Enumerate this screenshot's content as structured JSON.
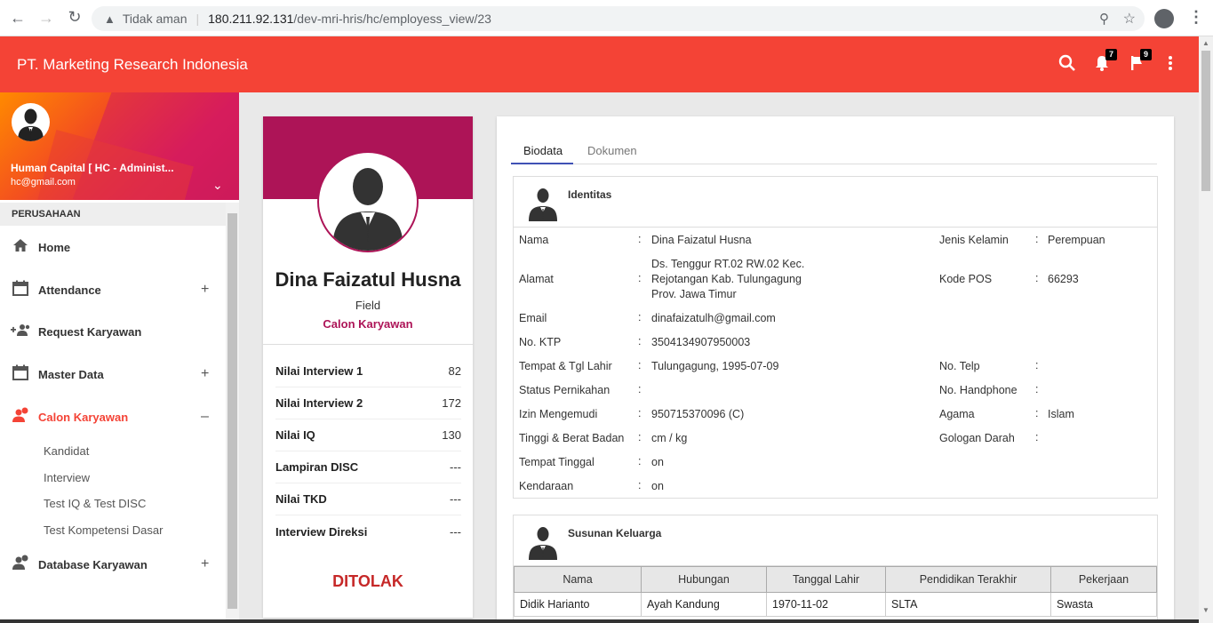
{
  "browser": {
    "insecure_label": "Tidak aman",
    "url_host": "180.211.92.131",
    "url_path": "/dev-mri-hris/hc/employess_view/23"
  },
  "header": {
    "brand": "PT. Marketing Research Indonesia",
    "notif_count": "7",
    "flag_count": "9"
  },
  "sidebar": {
    "user_name": "Human Capital [ HC - Administ...",
    "user_email": "hc@gmail.com",
    "section": "PERUSAHAAN",
    "items": [
      {
        "label": "Home",
        "icon": "home-icon"
      },
      {
        "label": "Attendance",
        "icon": "calendar-icon"
      },
      {
        "label": "Request Karyawan",
        "icon": "add-group-icon"
      },
      {
        "label": "Master Data",
        "icon": "calendar-icon"
      },
      {
        "label": "Calon Karyawan",
        "icon": "person-pin-icon"
      },
      {
        "label": "Database Karyawan",
        "icon": "person-pin-icon"
      }
    ],
    "sub_items": [
      "Kandidat",
      "Interview",
      "Test IQ & Test DISC",
      "Test Kompetensi Dasar"
    ],
    "accent": "#f44336"
  },
  "profile": {
    "name": "Dina Faizatul Husna",
    "dept": "Field",
    "status": "Calon Karyawan",
    "scores": [
      {
        "label": "Nilai Interview 1",
        "value": "82"
      },
      {
        "label": "Nilai Interview 2",
        "value": "172"
      },
      {
        "label": "Nilai IQ",
        "value": "130"
      },
      {
        "label": "Lampiran DISC",
        "value": "---"
      },
      {
        "label": "Nilai TKD",
        "value": "---"
      },
      {
        "label": "Interview Direksi",
        "value": "---"
      }
    ],
    "decision": "DITOLAK",
    "cover_color": "#ad1457"
  },
  "detail": {
    "tabs": [
      "Biodata",
      "Dokumen"
    ],
    "identitas": {
      "title": "Identitas",
      "nama_l": "Nama",
      "nama_v": "Dina Faizatul Husna",
      "alamat_l": "Alamat",
      "alamat_v1": "Ds. Tenggur RT.02 RW.02 Kec.",
      "alamat_v2": "Rejotangan Kab. Tulungagung",
      "alamat_v3": "Prov. Jawa Timur",
      "email_l": "Email",
      "email_v": "dinafaizatulh@gmail.com",
      "ktp_l": "No. KTP",
      "ktp_v": "3504134907950003",
      "ttl_l": "Tempat & Tgl Lahir",
      "ttl_v": "Tulungagung, 1995-07-09",
      "nikah_l": "Status Pernikahan",
      "nikah_v": "",
      "sim_l": "Izin Mengemudi",
      "sim_v": "950715370096 (C)",
      "tb_l": "Tinggi & Berat Badan",
      "tb_v": "cm / kg",
      "tinggal_l": "Tempat Tinggal",
      "tinggal_v": "on",
      "kendaraan_l": "Kendaraan",
      "kendaraan_v": "on",
      "jk_l": "Jenis Kelamin",
      "jk_v": "Perempuan",
      "pos_l": "Kode POS",
      "pos_v": "66293",
      "telp_l": "No. Telp",
      "telp_v": "",
      "hp_l": "No. Handphone",
      "hp_v": "",
      "agama_l": "Agama",
      "agama_v": "Islam",
      "darah_l": "Gologan Darah",
      "darah_v": ""
    },
    "keluarga": {
      "title": "Susunan Keluarga",
      "headers": [
        "Nama",
        "Hubungan",
        "Tanggal Lahir",
        "Pendidikan Terakhir",
        "Pekerjaan"
      ],
      "rows": [
        [
          "Didik Harianto",
          "Ayah Kandung",
          "1970-11-02",
          "SLTA",
          "Swasta"
        ]
      ]
    }
  }
}
